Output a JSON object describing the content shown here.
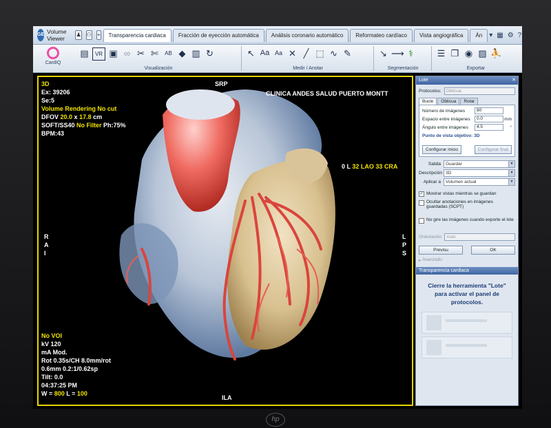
{
  "app": {
    "logo": "GE",
    "title": "Volume Viewer",
    "tabs": [
      {
        "label": "Transparencia cardiaca",
        "active": true
      },
      {
        "label": "Fracción de eyección automática"
      },
      {
        "label": "Análisis coronario automático"
      },
      {
        "label": "Reformateo cardíaco"
      },
      {
        "label": "Vista angiográfica"
      },
      {
        "label": "Án"
      }
    ]
  },
  "toolbar": {
    "cardiq": "CardIQ",
    "groups": [
      {
        "label": "Visualización",
        "icons": [
          "tile-icon",
          "vr-icon",
          "layout-icon",
          "link-icon",
          "scissors-icon",
          "scissors2-icon",
          "abc-icon",
          "cube-icon",
          "book-icon",
          "rotate-icon"
        ]
      },
      {
        "label": "Medir / Anotar",
        "icons": [
          "arrow-icon",
          "text-icon",
          "text2-icon",
          "measure-icon",
          "line-icon",
          "roi-icon",
          "curve-icon",
          "annotate-icon"
        ]
      },
      {
        "label": "Segmentación",
        "icons": [
          "seg1-icon",
          "seg2-icon",
          "seg3-icon"
        ]
      },
      {
        "label": "Exportar",
        "icons": [
          "list-icon",
          "copy-icon",
          "camera-icon",
          "save-icon",
          "run-icon"
        ]
      }
    ]
  },
  "overlay": {
    "mode": "3D",
    "exam": "Ex: 39206",
    "series": "Se:5",
    "rendering": "Volume Rendering No cut",
    "dfov_prefix": "DFOV ",
    "dfov_a": "20.0",
    "dfov_x": " x ",
    "dfov_b": "17.8",
    "dfov_unit": " cm",
    "filter_a": "SOFT/SS40 ",
    "filter_b": "No Filter",
    "filter_c": " Ph:75%",
    "bpm": "BPM:43",
    "institution": "CLINICA ANDES SALUD PUERTO MONTT",
    "top_orient": "SRP",
    "bottom_orient": "ILA",
    "left_orient": "R\nA\nI",
    "right_orient": "L\nP\nS",
    "angle_a": "0 L ",
    "angle_b": "32 LAO 33 CRA",
    "voi": "No VOI",
    "kv": "kV 120",
    "ma": "mA Mod.",
    "rot": "Rot 0.35s/CH 8.0mm/rot",
    "thick": "0.6mm 0.2:1/0.62sp",
    "tilt": "Tilt: 0.0",
    "time": "04:37:25 PM",
    "wl_a": "W = ",
    "wl_b": "800",
    "wl_c": " L = ",
    "wl_d": "100"
  },
  "panel": {
    "title": "Lote",
    "protocolos_label": "Protocolos:",
    "protocolos_value": "Oblicua",
    "tabs": [
      "Bucle",
      "Oblicua",
      "Rotar"
    ],
    "rows": [
      {
        "label": "Número de imágenes",
        "value": "80",
        "unit": ""
      },
      {
        "label": "Espacio entre imágenes",
        "value": "0.0",
        "unit": "mm"
      },
      {
        "label": "Ángulo entre imágenes",
        "value": "4.5",
        "unit": "°"
      }
    ],
    "objetivo": "Punto de vista objetivo: 3D",
    "btn_inicio": "Configurar inicio",
    "btn_final": "Configurar final",
    "salida_label": "Salida",
    "salida_value": "Guardar",
    "desc_label": "Descripción",
    "desc_value": "3D",
    "aplicar_label": "Aplicar a",
    "aplicar_value": "Volumen actual",
    "chk1": "Mostrar vistas mientras se guardan",
    "chk2": "Ocultar anotaciones en imágenes guardadas (SCPT)",
    "chk3": "No gire las imágenes cuando exporte el lote",
    "orient_label": "Orientación",
    "orient_value": "Auto",
    "btn_previsu": "Previsu",
    "btn_ok": "OK",
    "avanzado": "Avanzado",
    "section2": "Transparencia cardiaca",
    "message": "Cierre la herramienta \"Lote\" para activar el panel de protocolos."
  },
  "brand": "hp"
}
